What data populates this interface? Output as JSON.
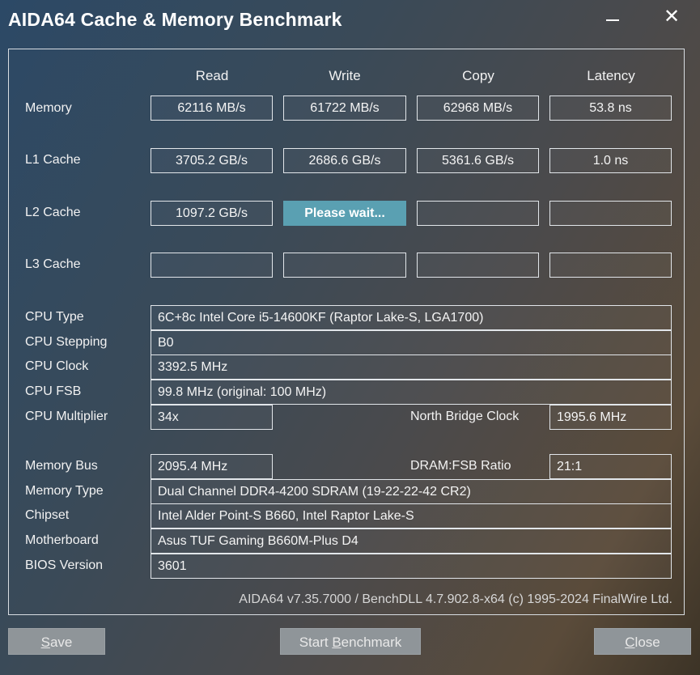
{
  "window": {
    "title": "AIDA64 Cache & Memory Benchmark"
  },
  "headers": {
    "read": "Read",
    "write": "Write",
    "copy": "Copy",
    "latency": "Latency"
  },
  "rows": {
    "memory": {
      "label": "Memory",
      "read": "62116 MB/s",
      "write": "61722 MB/s",
      "copy": "62968 MB/s",
      "latency": "53.8 ns"
    },
    "l1": {
      "label": "L1 Cache",
      "read": "3705.2 GB/s",
      "write": "2686.6 GB/s",
      "copy": "5361.6 GB/s",
      "latency": "1.0 ns"
    },
    "l2": {
      "label": "L2 Cache",
      "read": "1097.2 GB/s",
      "write": "Please wait...",
      "copy": "",
      "latency": ""
    },
    "l3": {
      "label": "L3 Cache",
      "read": "",
      "write": "",
      "copy": "",
      "latency": ""
    }
  },
  "info": {
    "cpu_type": {
      "label": "CPU Type",
      "value": "6C+8c Intel Core i5-14600KF  (Raptor Lake-S, LGA1700)"
    },
    "cpu_stepping": {
      "label": "CPU Stepping",
      "value": "B0"
    },
    "cpu_clock": {
      "label": "CPU Clock",
      "value": "3392.5 MHz"
    },
    "cpu_fsb": {
      "label": "CPU FSB",
      "value": "99.8 MHz  (original: 100 MHz)"
    },
    "cpu_multiplier": {
      "label": "CPU Multiplier",
      "value": "34x"
    },
    "nb_clock": {
      "label": "North Bridge Clock",
      "value": "1995.6 MHz"
    },
    "memory_bus": {
      "label": "Memory Bus",
      "value": "2095.4 MHz"
    },
    "dram_fsb": {
      "label": "DRAM:FSB Ratio",
      "value": "21:1"
    },
    "memory_type": {
      "label": "Memory Type",
      "value": "Dual Channel DDR4-4200 SDRAM  (19-22-22-42 CR2)"
    },
    "chipset": {
      "label": "Chipset",
      "value": "Intel Alder Point-S B660, Intel Raptor Lake-S"
    },
    "motherboard": {
      "label": "Motherboard",
      "value": "Asus TUF Gaming B660M-Plus D4"
    },
    "bios": {
      "label": "BIOS Version",
      "value": "3601"
    }
  },
  "footer": {
    "version": "AIDA64 v7.35.7000 / BenchDLL 4.7.902.8-x64  (c) 1995-2024 FinalWire Ltd."
  },
  "buttons": {
    "save": {
      "u": "S",
      "rest": "ave"
    },
    "start": {
      "pre": "Start ",
      "u": "B",
      "rest": "enchmark"
    },
    "close": {
      "u": "C",
      "rest": "lose"
    }
  },
  "colors": {
    "wait_accent": "#5aa0b2",
    "button_bg": "#8f9599"
  }
}
